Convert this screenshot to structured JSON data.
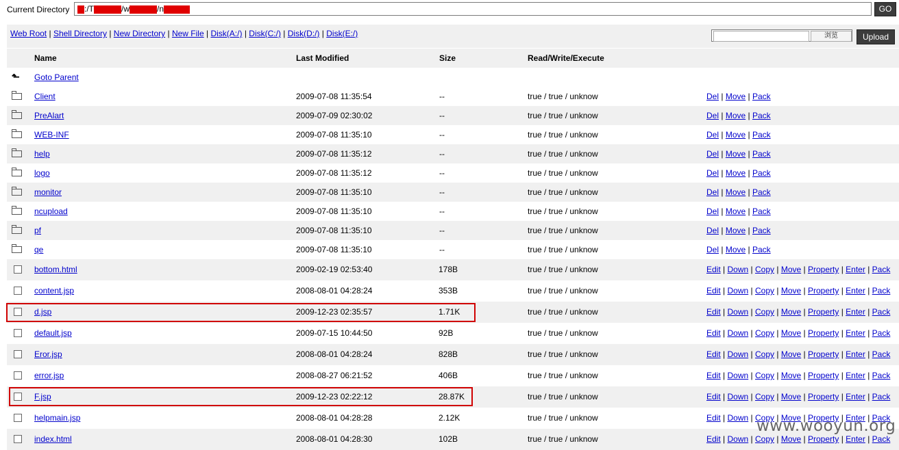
{
  "path_bar": {
    "label": "Current Directory",
    "segments": [
      ":/T",
      "/w",
      "/n"
    ],
    "go_label": "GO"
  },
  "toolbar": {
    "links": [
      "Web Root",
      "Shell Directory",
      "New Directory",
      "New File",
      "Disk(A:/)",
      "Disk(C:/)",
      "Disk(D:/)",
      "Disk(E:/)"
    ],
    "browse_label": "浏览",
    "upload_label": "Upload"
  },
  "columns": {
    "name": "Name",
    "modified": "Last Modified",
    "size": "Size",
    "rwx": "Read/Write/Execute"
  },
  "parent": {
    "icon": "up-arrow-icon",
    "label": "Goto Parent"
  },
  "directories": [
    {
      "name": "Client",
      "modified": "2009-07-08 11:35:54",
      "size": "--",
      "rwx": "true / true / unknow"
    },
    {
      "name": "PreAlart",
      "modified": "2009-07-09 02:30:02",
      "size": "--",
      "rwx": "true / true / unknow"
    },
    {
      "name": "WEB-INF",
      "modified": "2009-07-08 11:35:10",
      "size": "--",
      "rwx": "true / true / unknow"
    },
    {
      "name": "help",
      "modified": "2009-07-08 11:35:12",
      "size": "--",
      "rwx": "true / true / unknow"
    },
    {
      "name": "logo",
      "modified": "2009-07-08 11:35:12",
      "size": "--",
      "rwx": "true / true / unknow"
    },
    {
      "name": "monitor",
      "modified": "2009-07-08 11:35:10",
      "size": "--",
      "rwx": "true / true / unknow"
    },
    {
      "name": "ncupload",
      "modified": "2009-07-08 11:35:10",
      "size": "--",
      "rwx": "true / true / unknow"
    },
    {
      "name": "pf",
      "modified": "2009-07-08 11:35:10",
      "size": "--",
      "rwx": "true / true / unknow"
    },
    {
      "name": "qe",
      "modified": "2009-07-08 11:35:10",
      "size": "--",
      "rwx": "true / true / unknow"
    }
  ],
  "dir_actions": [
    "Del",
    "Move",
    "Pack"
  ],
  "files": [
    {
      "name": "bottom.html",
      "modified": "2009-02-19 02:53:40",
      "size": "178B",
      "rwx": "true / true / unknow",
      "highlighted": false
    },
    {
      "name": "content.jsp",
      "modified": "2008-08-01 04:28:24",
      "size": "353B",
      "rwx": "true / true / unknow",
      "highlighted": false
    },
    {
      "name": "d.jsp",
      "modified": "2009-12-23 02:35:57",
      "size": "1.71K",
      "rwx": "true / true / unknow",
      "highlighted": true
    },
    {
      "name": "default.jsp",
      "modified": "2009-07-15 10:44:50",
      "size": "92B",
      "rwx": "true / true / unknow",
      "highlighted": false
    },
    {
      "name": "Eror.jsp",
      "modified": "2008-08-01 04:28:24",
      "size": "828B",
      "rwx": "true / true / unknow",
      "highlighted": false
    },
    {
      "name": "error.jsp",
      "modified": "2008-08-27 06:21:52",
      "size": "406B",
      "rwx": "true / true / unknow",
      "highlighted": false
    },
    {
      "name": "F.jsp",
      "modified": "2009-12-23 02:22:12",
      "size": "28.87K",
      "rwx": "true / true / unknow",
      "highlighted": true
    },
    {
      "name": "helpmain.jsp",
      "modified": "2008-08-01 04:28:28",
      "size": "2.12K",
      "rwx": "true / true / unknow",
      "highlighted": false
    },
    {
      "name": "index.html",
      "modified": "2008-08-01 04:28:30",
      "size": "102B",
      "rwx": "true / true / unknow",
      "highlighted": false
    }
  ],
  "file_actions": [
    "Edit",
    "Down",
    "Copy",
    "Move",
    "Property",
    "Enter",
    "Pack"
  ],
  "watermark": "www.wooyun.org",
  "colors": {
    "link": "#0000cc",
    "highlight_box": "#d00000",
    "redaction": "#e00000",
    "alt_row": "#f0f0f0"
  }
}
